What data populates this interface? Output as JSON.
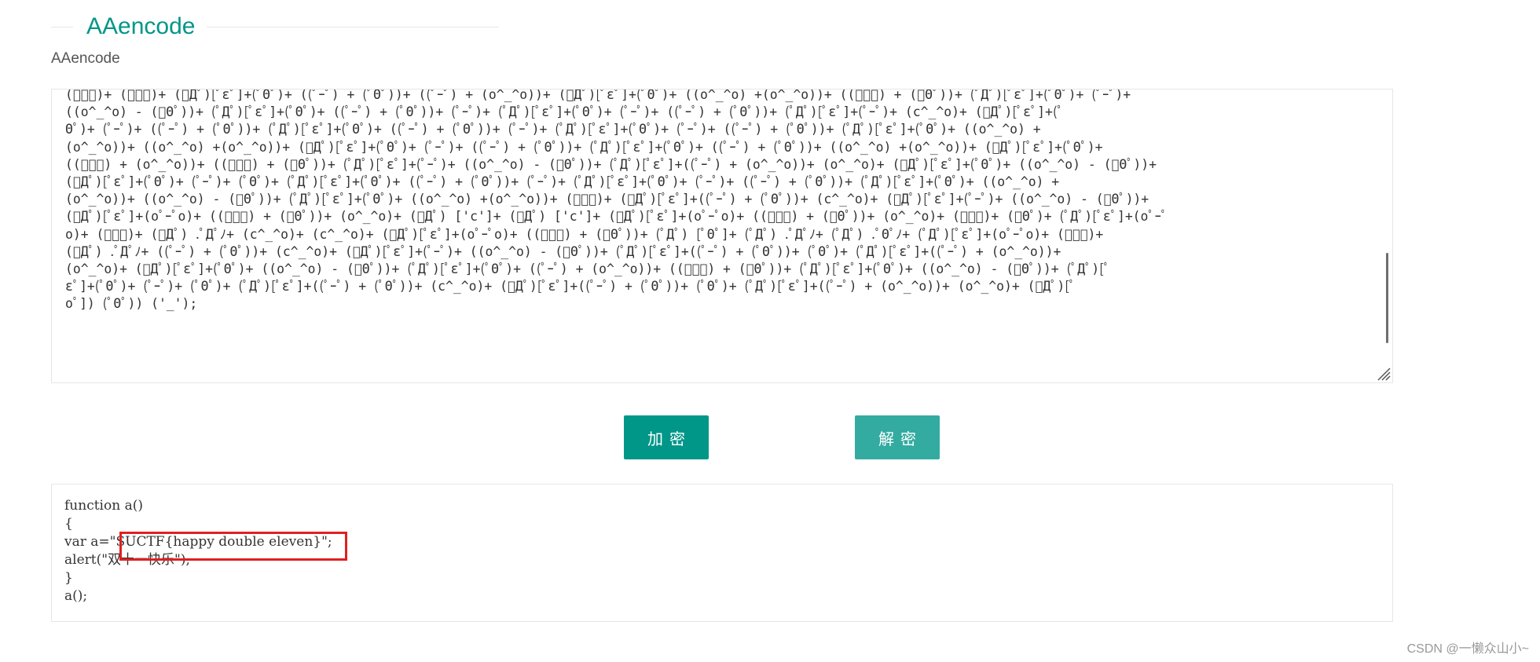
{
  "header": {
    "title": "AAencode"
  },
  "section": {
    "label": "AAencode"
  },
  "encoded": {
    "text": "(ﾟｰﾟ)+ (ﾟｰﾟ)+ (ﾟДﾟ)[ﾟεﾟ]+(ﾟΘﾟ)+ ((ﾟｰﾟ) + (ﾟΘﾟ))+ ((ﾟｰﾟ) + (o^_^o))+ (ﾟДﾟ)[ﾟεﾟ]+(ﾟΘﾟ)+ ((o^_^o) +(o^_^o))+ ((ﾟｰﾟ) + (ﾟΘﾟ))+ (ﾟДﾟ)[ﾟεﾟ]+(ﾟΘﾟ)+ (ﾟｰﾟ)+\n((o^_^o) - (ﾟΘﾟ))+ (ﾟДﾟ)[ﾟεﾟ]+(ﾟΘﾟ)+ ((ﾟｰﾟ) + (ﾟΘﾟ))+ (ﾟｰﾟ)+ (ﾟДﾟ)[ﾟεﾟ]+(ﾟΘﾟ)+ (ﾟｰﾟ)+ ((ﾟｰﾟ) + (ﾟΘﾟ))+ (ﾟДﾟ)[ﾟεﾟ]+(ﾟｰﾟ)+ (c^_^o)+ (ﾟДﾟ)[ﾟεﾟ]+(ﾟ\nΘﾟ)+ (ﾟｰﾟ)+ ((ﾟｰﾟ) + (ﾟΘﾟ))+ (ﾟДﾟ)[ﾟεﾟ]+(ﾟΘﾟ)+ ((ﾟｰﾟ) + (ﾟΘﾟ))+ (ﾟｰﾟ)+ (ﾟДﾟ)[ﾟεﾟ]+(ﾟΘﾟ)+ (ﾟｰﾟ)+ ((ﾟｰﾟ) + (ﾟΘﾟ))+ (ﾟДﾟ)[ﾟεﾟ]+(ﾟΘﾟ)+ ((o^_^o) +\n(o^_^o))+ ((o^_^o) +(o^_^o))+ (ﾟДﾟ)[ﾟεﾟ]+(ﾟΘﾟ)+ (ﾟｰﾟ)+ ((ﾟｰﾟ) + (ﾟΘﾟ))+ (ﾟДﾟ)[ﾟεﾟ]+(ﾟΘﾟ)+ ((ﾟｰﾟ) + (ﾟΘﾟ))+ ((o^_^o) +(o^_^o))+ (ﾟДﾟ)[ﾟεﾟ]+(ﾟΘﾟ)+\n((ﾟｰﾟ) + (o^_^o))+ ((ﾟｰﾟ) + (ﾟΘﾟ))+ (ﾟДﾟ)[ﾟεﾟ]+(ﾟｰﾟ)+ ((o^_^o) - (ﾟΘﾟ))+ (ﾟДﾟ)[ﾟεﾟ]+((ﾟｰﾟ) + (o^_^o))+ (o^_^o)+ (ﾟДﾟ)[ﾟεﾟ]+(ﾟΘﾟ)+ ((o^_^o) - (ﾟΘﾟ))+\n(ﾟДﾟ)[ﾟεﾟ]+(ﾟΘﾟ)+ (ﾟｰﾟ)+ (ﾟΘﾟ)+ (ﾟДﾟ)[ﾟεﾟ]+(ﾟΘﾟ)+ ((ﾟｰﾟ) + (ﾟΘﾟ))+ (ﾟｰﾟ)+ (ﾟДﾟ)[ﾟεﾟ]+(ﾟΘﾟ)+ (ﾟｰﾟ)+ ((ﾟｰﾟ) + (ﾟΘﾟ))+ (ﾟДﾟ)[ﾟεﾟ]+(ﾟΘﾟ)+ ((o^_^o) +\n(o^_^o))+ ((o^_^o) - (ﾟΘﾟ))+ (ﾟДﾟ)[ﾟεﾟ]+(ﾟΘﾟ)+ ((o^_^o) +(o^_^o))+ (ﾟｰﾟ)+ (ﾟДﾟ)[ﾟεﾟ]+((ﾟｰﾟ) + (ﾟΘﾟ))+ (c^_^o)+ (ﾟДﾟ)[ﾟεﾟ]+(ﾟｰﾟ)+ ((o^_^o) - (ﾟΘﾟ))+\n(ﾟДﾟ)[ﾟεﾟ]+(oﾟｰﾟo)+ ((ﾟｰﾟ) + (ﾟΘﾟ))+ (o^_^o)+ (ﾟДﾟ) ['c']+ (ﾟДﾟ) ['c']+ (ﾟДﾟ)[ﾟεﾟ]+(oﾟｰﾟo)+ ((ﾟｰﾟ) + (ﾟΘﾟ))+ (o^_^o)+ (ﾟｰﾟ)+ (ﾟΘﾟ)+ (ﾟДﾟ)[ﾟεﾟ]+(oﾟｰﾟ\no)+ (ﾟｰﾟ)+ (ﾟДﾟ) .ﾟДﾟﾉ+ (c^_^o)+ (c^_^o)+ (ﾟДﾟ)[ﾟεﾟ]+(oﾟｰﾟo)+ ((ﾟｰﾟ) + (ﾟΘﾟ))+ (ﾟДﾟ) [ﾟΘﾟ]+ (ﾟДﾟ) .ﾟДﾟﾉ+ (ﾟДﾟ) .ﾟΘﾟﾉ+ (ﾟДﾟ)[ﾟεﾟ]+(oﾟｰﾟo)+ (ﾟｰﾟ)+\n(ﾟДﾟ) .ﾟДﾟﾉ+ ((ﾟｰﾟ) + (ﾟΘﾟ))+ (c^_^o)+ (ﾟДﾟ)[ﾟεﾟ]+(ﾟｰﾟ)+ ((o^_^o) - (ﾟΘﾟ))+ (ﾟДﾟ)[ﾟεﾟ]+((ﾟｰﾟ) + (ﾟΘﾟ))+ (ﾟΘﾟ)+ (ﾟДﾟ)[ﾟεﾟ]+((ﾟｰﾟ) + (o^_^o))+\n(o^_^o)+ (ﾟДﾟ)[ﾟεﾟ]+(ﾟΘﾟ)+ ((o^_^o) - (ﾟΘﾟ))+ (ﾟДﾟ)[ﾟεﾟ]+(ﾟΘﾟ)+ ((ﾟｰﾟ) + (o^_^o))+ ((ﾟｰﾟ) + (ﾟΘﾟ))+ (ﾟДﾟ)[ﾟεﾟ]+(ﾟΘﾟ)+ ((o^_^o) - (ﾟΘﾟ))+ (ﾟДﾟ)[ﾟ\nεﾟ]+(ﾟΘﾟ)+ (ﾟｰﾟ)+ (ﾟΘﾟ)+ (ﾟДﾟ)[ﾟεﾟ]+((ﾟｰﾟ) + (ﾟΘﾟ))+ (c^_^o)+ (ﾟДﾟ)[ﾟεﾟ]+((ﾟｰﾟ) + (ﾟΘﾟ))+ (ﾟΘﾟ)+ (ﾟДﾟ)[ﾟεﾟ]+((ﾟｰﾟ) + (o^_^o))+ (o^_^o)+ (ﾟДﾟ)[ﾟ\noﾟ]) (ﾟΘﾟ)) ('_');"
  },
  "buttons": {
    "encrypt_label": "加密",
    "decrypt_label": "解密"
  },
  "output": {
    "lines": [
      "function a()",
      "{",
      "var a=\"SUCTF{happy double eleven}\";",
      "alert(\"双十一快乐\");",
      "}",
      "a();"
    ]
  },
  "watermark": {
    "text": "CSDN @一懒众山小~"
  },
  "colors": {
    "accent": "#009688",
    "highlight": "#e02020"
  }
}
